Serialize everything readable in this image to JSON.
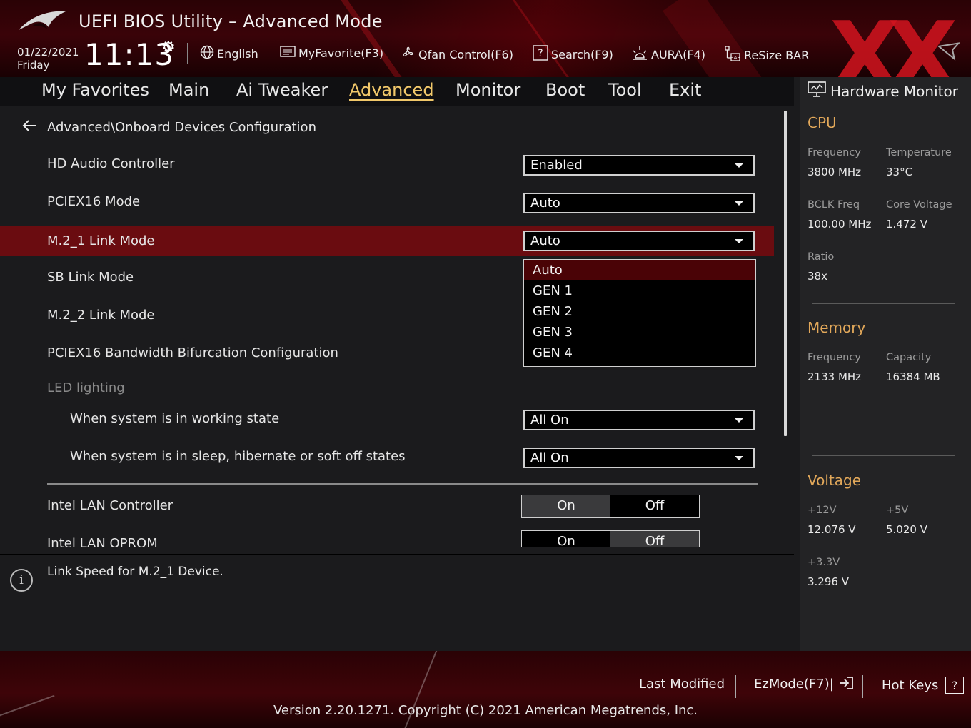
{
  "header": {
    "title": "UEFI BIOS Utility – Advanced Mode",
    "date": "01/22/2021",
    "day": "Friday",
    "time": "11:13",
    "tools": [
      {
        "label": "English",
        "icon": "globe-icon"
      },
      {
        "label": "MyFavorite(F3)",
        "icon": "favorite-list-icon"
      },
      {
        "label": "Qfan Control(F6)",
        "icon": "fan-icon"
      },
      {
        "label": "Search(F9)",
        "icon": "search-help-icon"
      },
      {
        "label": "AURA(F4)",
        "icon": "aura-light-icon"
      },
      {
        "label": "ReSize BAR",
        "icon": "resize-bar-icon"
      }
    ]
  },
  "nav": {
    "tabs": [
      "My Favorites",
      "Main",
      "Ai Tweaker",
      "Advanced",
      "Monitor",
      "Boot",
      "Tool",
      "Exit"
    ],
    "active": "Advanced"
  },
  "main": {
    "breadcrumb": "Advanced\\Onboard Devices Configuration",
    "settings": [
      {
        "label": "HD Audio Controller",
        "value": "Enabled"
      },
      {
        "label": "PCIEX16 Mode",
        "value": "Auto"
      },
      {
        "label": "M.2_1 Link Mode",
        "value": "Auto"
      },
      {
        "label": "SB Link Mode"
      },
      {
        "label": "M.2_2 Link Mode"
      },
      {
        "label": "PCIEX16 Bandwidth Bifurcation Configuration"
      }
    ],
    "dropdown_options": [
      "Auto",
      "GEN 1",
      "GEN 2",
      "GEN 3",
      "GEN 4"
    ],
    "led_group": "LED lighting",
    "led_settings": [
      {
        "label": "When system is in working state",
        "value": "All On"
      },
      {
        "label": "When system is in sleep, hibernate or soft off states",
        "value": "All On"
      }
    ],
    "lan": {
      "label": "Intel LAN Controller",
      "on": "On",
      "off": "Off"
    },
    "lan_oprom": {
      "label": "Intel LAN OPROM",
      "on": "On",
      "off": "Off"
    }
  },
  "help": {
    "text": "Link Speed for M.2_1 Device.",
    "icon": "info-icon"
  },
  "hardware_monitor": {
    "title": "Hardware Monitor",
    "cpu": {
      "heading": "CPU",
      "frequency_label": "Frequency",
      "frequency": "3800 MHz",
      "temperature_label": "Temperature",
      "temperature": "33°C",
      "bclk_label": "BCLK Freq",
      "bclk": "100.00 MHz",
      "core_voltage_label": "Core Voltage",
      "core_voltage": "1.472 V",
      "ratio_label": "Ratio",
      "ratio": "38x"
    },
    "memory": {
      "heading": "Memory",
      "frequency_label": "Frequency",
      "frequency": "2133 MHz",
      "capacity_label": "Capacity",
      "capacity": "16384 MB"
    },
    "voltage": {
      "heading": "Voltage",
      "v12_label": "+12V",
      "v12": "12.076 V",
      "v5_label": "+5V",
      "v5": "5.020 V",
      "v33_label": "+3.3V",
      "v33": "3.296 V"
    }
  },
  "footer": {
    "last_modified": "Last Modified",
    "ezmode": "EzMode(F7)|",
    "hotkeys": "Hot Keys",
    "hotkeys_box": "?",
    "version": "Version 2.20.1271. Copyright (C) 2021 American Megatrends, Inc."
  },
  "colors": {
    "accent": "#f1c86a",
    "selection": "#6a0c10",
    "brand_red": "#c8141e"
  }
}
